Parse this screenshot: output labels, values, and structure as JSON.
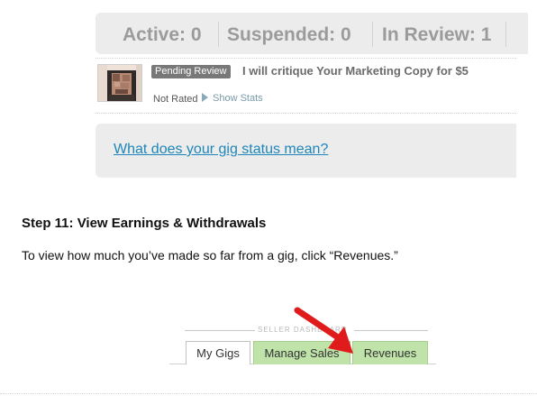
{
  "status_bar": {
    "active": "Active: 0",
    "suspended": "Suspended: 0",
    "in_review": "In Review: 1"
  },
  "gig": {
    "badge": "Pending Review",
    "title": "I will critique Your Marketing Copy for $5",
    "rating": "Not Rated",
    "stats_link": "Show Stats"
  },
  "info_box": {
    "link": "What does your gig status mean?"
  },
  "step": {
    "heading": "Step 11: View Earnings & Withdrawals",
    "body": "To view how much you’ve made so far from a gig, click “Revenues.”"
  },
  "dashboard": {
    "label": "SELLER DASHBOARD",
    "tabs": [
      "My Gigs",
      "Manage Sales",
      "Revenues"
    ]
  },
  "colors": {
    "active_tab": "#ffffff",
    "green_tab": "#bfe3a9",
    "arrow": "#e01b1b",
    "link": "#1e86b8",
    "badge": "#787878"
  }
}
